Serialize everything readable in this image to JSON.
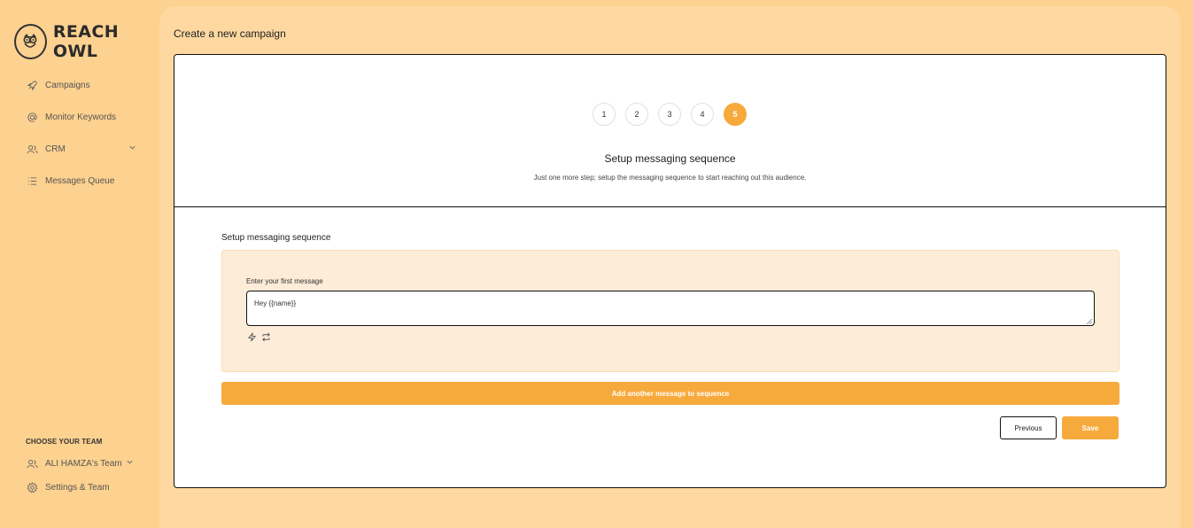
{
  "brand": {
    "name": "REACH OWL",
    "logo_icon": "owl-logo-icon"
  },
  "sidebar": {
    "items": [
      {
        "label": "Campaigns",
        "icon": "rocket-icon"
      },
      {
        "label": "Monitor Keywords",
        "icon": "at-icon"
      },
      {
        "label": "CRM",
        "icon": "users-icon"
      },
      {
        "label": "Messages Queue",
        "icon": "list-icon"
      }
    ],
    "team_heading": "CHOOSE YOUR TEAM",
    "team_name": "ALI HAMZA's Team",
    "settings_label": "Settings & Team"
  },
  "page": {
    "title": "Create a new campaign"
  },
  "stepper": {
    "steps": [
      "1",
      "2",
      "3",
      "4",
      "5"
    ],
    "active_step": "5"
  },
  "header": {
    "title": "Setup messaging sequence",
    "subtitle": "Just one more step; setup the messaging sequence to start reaching out this audience."
  },
  "sequence": {
    "section_title": "Setup messaging sequence",
    "first_message_label": "Enter your first message",
    "first_message_value": "Hey {{name}}",
    "add_button_label": "Add another message to sequence"
  },
  "actions": {
    "previous_label": "Previous",
    "save_label": "Save"
  },
  "colors": {
    "accent": "#f7aa3c",
    "sidebar_bg": "#fdd18f",
    "main_bg": "#fed8a0",
    "message_bg": "#fdecd8"
  }
}
